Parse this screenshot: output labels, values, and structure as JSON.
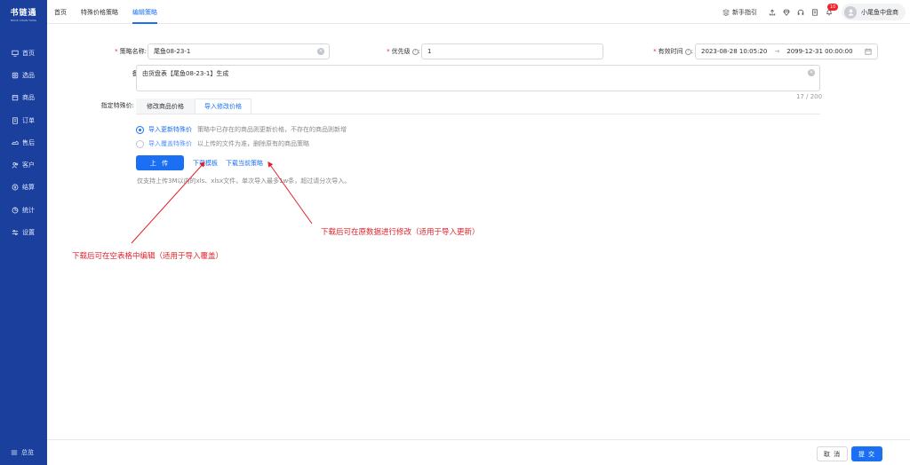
{
  "sidebar": {
    "logo": "书链通",
    "logo_sub": "BOOK CHAIN TONG",
    "items": [
      {
        "label": "首页",
        "icon": "monitor-icon"
      },
      {
        "label": "选品",
        "icon": "select-icon"
      },
      {
        "label": "商品",
        "icon": "goods-icon"
      },
      {
        "label": "订单",
        "icon": "order-icon"
      },
      {
        "label": "售后",
        "icon": "aftersale-icon"
      },
      {
        "label": "客户",
        "icon": "customer-icon"
      },
      {
        "label": "结算",
        "icon": "settle-icon"
      },
      {
        "label": "统计",
        "icon": "stats-icon"
      },
      {
        "label": "设置",
        "icon": "settings-icon"
      }
    ],
    "bottom_label": "总览"
  },
  "header": {
    "tabs": [
      {
        "label": "首页"
      },
      {
        "label": "特殊价格策略"
      },
      {
        "label": "编辑策略"
      }
    ],
    "guide_label": "新手指引",
    "badge_count": "10",
    "user_name": "小尾鱼中盘商"
  },
  "form": {
    "name_label": "策略名称:",
    "name_value": "尾鱼08-23-1",
    "priority_label": "优先级",
    "priority_value": "1",
    "valid_label": "有效时间",
    "valid_start": "2023-08-28 10:05:20",
    "valid_arrow": "→",
    "valid_end": "2099-12-31 00:00:00",
    "remark_label": "备注:",
    "remark_value": "由货盘表【尾鱼08-23-1】生成",
    "remark_count": "17 / 200",
    "special_label": "指定特殊价:",
    "tabs": [
      {
        "label": "修改商品价格"
      },
      {
        "label": "导入修改价格"
      }
    ],
    "radio_update_label": "导入更新特殊价",
    "radio_update_desc": "策略中已存在的商品则更新价格，不存在的商品则新增",
    "radio_cover_label": "导入覆盖特殊价",
    "radio_cover_desc": "以上传的文件为准，删除原有的商品策略",
    "upload_label": "上 传",
    "download_template": "下载模板",
    "download_current": "下载当前策略",
    "hint": "仅支持上传3M以内的xls、xlsx文件，单次导入最多1w条，超过请分次导入。"
  },
  "annotations": {
    "right": "下载后可在原数据进行修改（适用于导入更新）",
    "left": "下载后可在空表格中编辑（适用于导入覆盖）"
  },
  "footer": {
    "cancel_label": "取 消",
    "submit_label": "提 交"
  },
  "colors": {
    "sidebar": "#1b3f9c",
    "primary": "#1a6ff3",
    "annotation": "#e0202a"
  }
}
